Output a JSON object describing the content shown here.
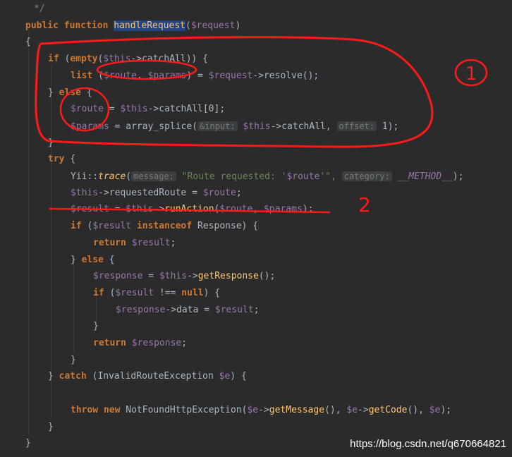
{
  "editor": {
    "lines": [
      {
        "indent": 48,
        "tokens": [
          {
            "t": "*/",
            "c": "comment"
          }
        ]
      },
      {
        "indent": 36,
        "tokens": [
          {
            "t": "public ",
            "c": "kw"
          },
          {
            "t": "function ",
            "c": "kw"
          },
          {
            "t": "handleRequest",
            "c": "fn hl"
          },
          {
            "t": "(",
            "c": "plain"
          },
          {
            "t": "$request",
            "c": "var"
          },
          {
            "t": ")",
            "c": "plain"
          }
        ]
      },
      {
        "indent": 36,
        "tokens": [
          {
            "t": "{",
            "c": "plain"
          }
        ]
      },
      {
        "indent": 68,
        "tokens": [
          {
            "t": "if ",
            "c": "kw"
          },
          {
            "t": "(",
            "c": "plain"
          },
          {
            "t": "empty",
            "c": "kw"
          },
          {
            "t": "(",
            "c": "plain"
          },
          {
            "t": "$this",
            "c": "var"
          },
          {
            "t": "->catchAll)) {",
            "c": "plain"
          }
        ]
      },
      {
        "indent": 100,
        "tokens": [
          {
            "t": "list ",
            "c": "kw"
          },
          {
            "t": "(",
            "c": "plain"
          },
          {
            "t": "$route",
            "c": "var"
          },
          {
            "t": ", ",
            "c": "plain"
          },
          {
            "t": "$params",
            "c": "var"
          },
          {
            "t": ") = ",
            "c": "plain"
          },
          {
            "t": "$request",
            "c": "var"
          },
          {
            "t": "->resolve();",
            "c": "plain"
          }
        ]
      },
      {
        "indent": 68,
        "tokens": [
          {
            "t": "} ",
            "c": "plain"
          },
          {
            "t": "else ",
            "c": "kw"
          },
          {
            "t": "{",
            "c": "plain"
          }
        ]
      },
      {
        "indent": 100,
        "tokens": [
          {
            "t": "$route",
            "c": "var"
          },
          {
            "t": " = ",
            "c": "plain"
          },
          {
            "t": "$this",
            "c": "var"
          },
          {
            "t": "->catchAll[0];",
            "c": "plain"
          }
        ]
      },
      {
        "indent": 100,
        "tokens": [
          {
            "t": "$params",
            "c": "var"
          },
          {
            "t": " = array_splice(",
            "c": "plain"
          },
          {
            "t": "&input:",
            "c": "hint"
          },
          {
            "t": " ",
            "c": "plain"
          },
          {
            "t": "$this",
            "c": "var"
          },
          {
            "t": "->catchAll, ",
            "c": "plain"
          },
          {
            "t": "offset:",
            "c": "hint"
          },
          {
            "t": " 1);",
            "c": "plain"
          }
        ]
      },
      {
        "indent": 68,
        "tokens": [
          {
            "t": "}",
            "c": "plain"
          }
        ]
      },
      {
        "indent": 68,
        "tokens": [
          {
            "t": "try ",
            "c": "kw"
          },
          {
            "t": "{",
            "c": "plain"
          }
        ]
      },
      {
        "indent": 100,
        "tokens": [
          {
            "t": "Yii::",
            "c": "plain"
          },
          {
            "t": "trace",
            "c": "fn ital"
          },
          {
            "t": "(",
            "c": "plain"
          },
          {
            "t": "message:",
            "c": "hint"
          },
          {
            "t": " \"Route requested: '",
            "c": "str"
          },
          {
            "t": "$route",
            "c": "var"
          },
          {
            "t": "'\", ",
            "c": "str"
          },
          {
            "t": "category:",
            "c": "hint"
          },
          {
            "t": " __METHOD__",
            "c": "var ital"
          },
          {
            "t": ");",
            "c": "plain"
          }
        ]
      },
      {
        "indent": 100,
        "tokens": [
          {
            "t": "$this",
            "c": "var"
          },
          {
            "t": "->requestedRoute = ",
            "c": "plain"
          },
          {
            "t": "$route",
            "c": "var"
          },
          {
            "t": ";",
            "c": "plain"
          }
        ]
      },
      {
        "indent": 100,
        "tokens": [
          {
            "t": "$result",
            "c": "var"
          },
          {
            "t": " = ",
            "c": "plain"
          },
          {
            "t": "$this",
            "c": "var"
          },
          {
            "t": "->",
            "c": "plain"
          },
          {
            "t": "runAction",
            "c": "fn"
          },
          {
            "t": "(",
            "c": "plain"
          },
          {
            "t": "$route",
            "c": "var"
          },
          {
            "t": ", ",
            "c": "plain"
          },
          {
            "t": "$params",
            "c": "var"
          },
          {
            "t": ");",
            "c": "plain"
          }
        ]
      },
      {
        "indent": 100,
        "tokens": [
          {
            "t": "if ",
            "c": "kw"
          },
          {
            "t": "(",
            "c": "plain"
          },
          {
            "t": "$result ",
            "c": "var"
          },
          {
            "t": "instanceof ",
            "c": "kw"
          },
          {
            "t": "Response) {",
            "c": "plain"
          }
        ]
      },
      {
        "indent": 132,
        "tokens": [
          {
            "t": "return ",
            "c": "kw"
          },
          {
            "t": "$result",
            "c": "var"
          },
          {
            "t": ";",
            "c": "plain"
          }
        ]
      },
      {
        "indent": 100,
        "tokens": [
          {
            "t": "} ",
            "c": "plain"
          },
          {
            "t": "else ",
            "c": "kw"
          },
          {
            "t": "{",
            "c": "plain"
          }
        ]
      },
      {
        "indent": 132,
        "tokens": [
          {
            "t": "$response",
            "c": "var"
          },
          {
            "t": " = ",
            "c": "plain"
          },
          {
            "t": "$this",
            "c": "var"
          },
          {
            "t": "->",
            "c": "plain"
          },
          {
            "t": "getResponse",
            "c": "fn"
          },
          {
            "t": "();",
            "c": "plain"
          }
        ]
      },
      {
        "indent": 132,
        "tokens": [
          {
            "t": "if ",
            "c": "kw"
          },
          {
            "t": "(",
            "c": "plain"
          },
          {
            "t": "$result",
            "c": "var"
          },
          {
            "t": " !== ",
            "c": "plain"
          },
          {
            "t": "null",
            "c": "kw"
          },
          {
            "t": ") {",
            "c": "plain"
          }
        ]
      },
      {
        "indent": 164,
        "tokens": [
          {
            "t": "$response",
            "c": "var"
          },
          {
            "t": "->data = ",
            "c": "plain"
          },
          {
            "t": "$result",
            "c": "var"
          },
          {
            "t": ";",
            "c": "plain"
          }
        ]
      },
      {
        "indent": 132,
        "tokens": [
          {
            "t": "}",
            "c": "plain"
          }
        ]
      },
      {
        "indent": 132,
        "tokens": [
          {
            "t": "return ",
            "c": "kw"
          },
          {
            "t": "$response",
            "c": "var"
          },
          {
            "t": ";",
            "c": "plain"
          }
        ]
      },
      {
        "indent": 100,
        "tokens": [
          {
            "t": "}",
            "c": "plain"
          }
        ]
      },
      {
        "indent": 68,
        "tokens": [
          {
            "t": "} ",
            "c": "plain"
          },
          {
            "t": "catch ",
            "c": "kw"
          },
          {
            "t": "(InvalidRouteException ",
            "c": "plain"
          },
          {
            "t": "$e",
            "c": "var"
          },
          {
            "t": ") {",
            "c": "plain"
          }
        ]
      },
      {
        "indent": 68,
        "tokens": []
      },
      {
        "indent": 100,
        "tokens": [
          {
            "t": "throw ",
            "c": "kw"
          },
          {
            "t": "new ",
            "c": "kw"
          },
          {
            "t": "NotFoundHttpException(",
            "c": "plain"
          },
          {
            "t": "$e",
            "c": "var"
          },
          {
            "t": "->",
            "c": "plain"
          },
          {
            "t": "getMessage",
            "c": "fn"
          },
          {
            "t": "(), ",
            "c": "plain"
          },
          {
            "t": "$e",
            "c": "var"
          },
          {
            "t": "->",
            "c": "plain"
          },
          {
            "t": "getCode",
            "c": "fn"
          },
          {
            "t": "(), ",
            "c": "plain"
          },
          {
            "t": "$e",
            "c": "var"
          },
          {
            "t": ");",
            "c": "plain"
          }
        ]
      },
      {
        "indent": 68,
        "tokens": [
          {
            "t": "}",
            "c": "plain"
          }
        ]
      },
      {
        "indent": 36,
        "tokens": [
          {
            "t": "}",
            "c": "plain"
          }
        ]
      }
    ]
  },
  "annotations": {
    "label_1": "1",
    "label_2": "2"
  },
  "watermark": "https://blog.csdn.net/q670664821",
  "colors": {
    "background": "#2b2b2b",
    "keyword": "#cc7832",
    "function": "#ffc66d",
    "variable": "#9876aa",
    "text": "#a9b7c6",
    "string": "#6a8759",
    "annotation_red": "#ff1a1a"
  }
}
